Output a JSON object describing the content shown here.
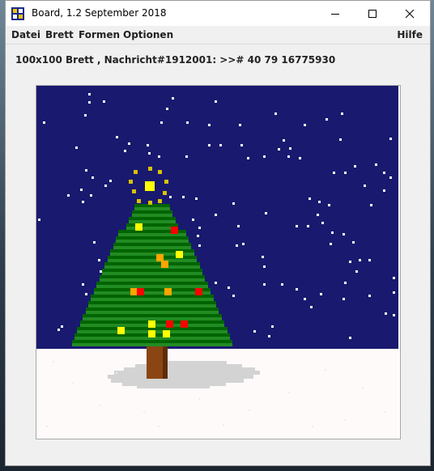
{
  "window": {
    "title": "Board, 1.2 September 2018",
    "controls": {
      "minimize_icon": "minimize-icon",
      "maximize_icon": "maximize-icon",
      "close_icon": "close-icon"
    }
  },
  "menu": {
    "datei": "Datei",
    "brett": "Brett",
    "formen": "Formen",
    "optionen": "Optionen",
    "hilfe": "Hilfe"
  },
  "status_line": "100x100 Brett , Nachricht#1912001: >># 40 79 16775930",
  "board": {
    "grid_size": [
      100,
      100
    ],
    "colors": {
      "sky": "#191970",
      "snow_ground": "#fffafa",
      "snowflake": "#ffffff",
      "shadow": "#d3d3d3",
      "tree_dark": "#006400",
      "tree_light": "#228b22",
      "trunk": "#8b4513",
      "trunk_dark": "#5c2e0c",
      "star": "#ffff00",
      "ornament_red": "#ff0000",
      "ornament_orange": "#ffa500",
      "ornament_yellow": "#ffff00"
    }
  }
}
